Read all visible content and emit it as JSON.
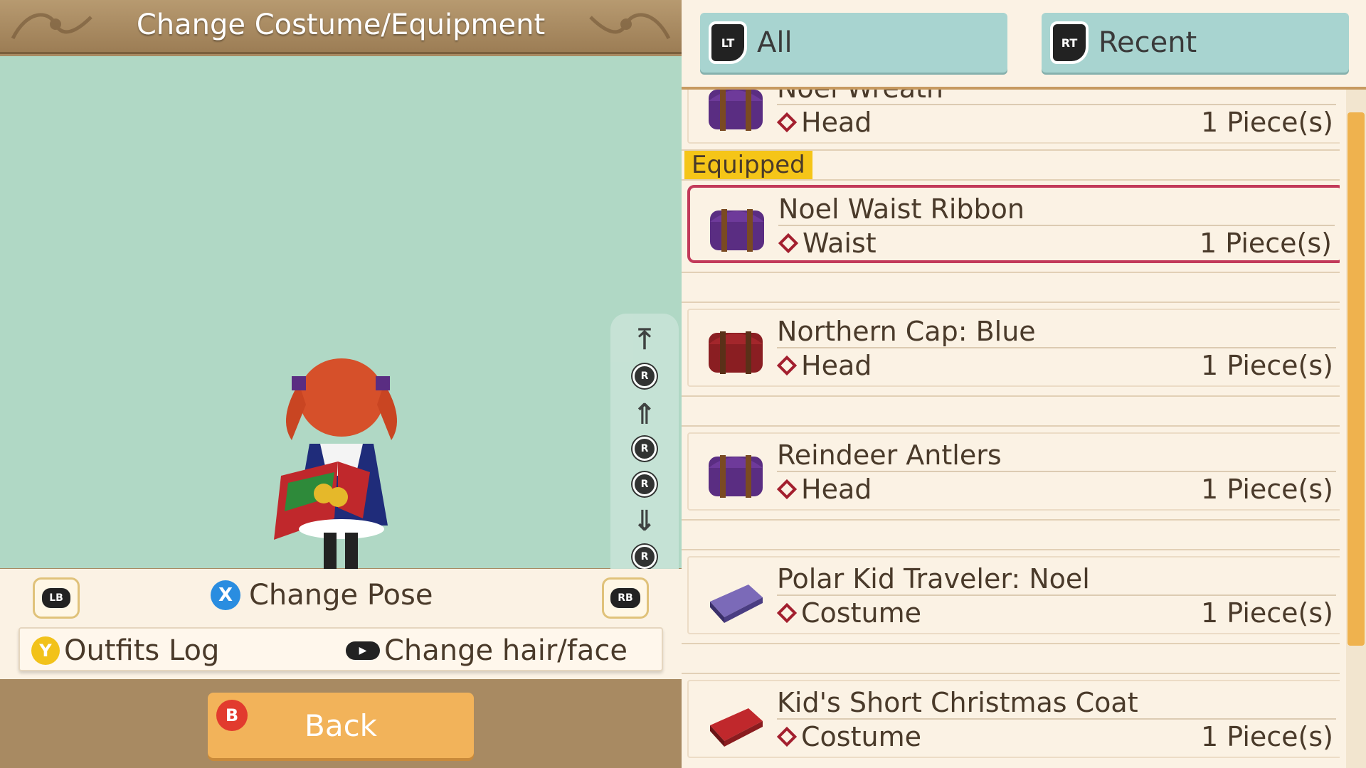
{
  "header": {
    "title": "Change Costume/Equipment"
  },
  "camera_controls": {
    "r_label": "R"
  },
  "controls": {
    "lb_label": "LB",
    "rb_label": "RB",
    "change_pose_button": "X",
    "change_pose_label": "Change Pose",
    "outfits_log_button": "Y",
    "outfits_log_label": "Outfits Log",
    "change_hair_label": "Change hair/face"
  },
  "back": {
    "button": "B",
    "label": "Back"
  },
  "tabs": [
    {
      "badge": "LT",
      "label": "All"
    },
    {
      "badge": "RT",
      "label": "Recent"
    }
  ],
  "equipped_label": "Equipped",
  "items": [
    {
      "name": "Noel Wreath",
      "slot": "Head",
      "count": "1 Piece(s)",
      "chest_color": "#5a2d82"
    },
    {
      "name": "Noel Waist Ribbon",
      "slot": "Waist",
      "count": "1 Piece(s)",
      "chest_color": "#5a2d82",
      "selected": true
    },
    {
      "name": "Northern Cap: Blue",
      "slot": "Head",
      "count": "1 Piece(s)",
      "chest_color": "#8a1e22"
    },
    {
      "name": "Reindeer Antlers",
      "slot": "Head",
      "count": "1 Piece(s)",
      "chest_color": "#5a2d82"
    },
    {
      "name": "Polar Kid Traveler: Noel",
      "slot": "Costume",
      "count": "1 Piece(s)",
      "chest_color": "#7b6ab8"
    },
    {
      "name": "Kid's Short Christmas Coat",
      "slot": "Costume",
      "count": "1 Piece(s)",
      "chest_color": "#c0282c"
    }
  ],
  "colors": {
    "viewport_bg": "#b0d8c5",
    "tab_bg": "#a8d4d0",
    "selected_border": "#c23a5a",
    "equipped_tag": "#f5c518",
    "back_button": "#f2b35a",
    "scroll_thumb": "#efb24e"
  }
}
